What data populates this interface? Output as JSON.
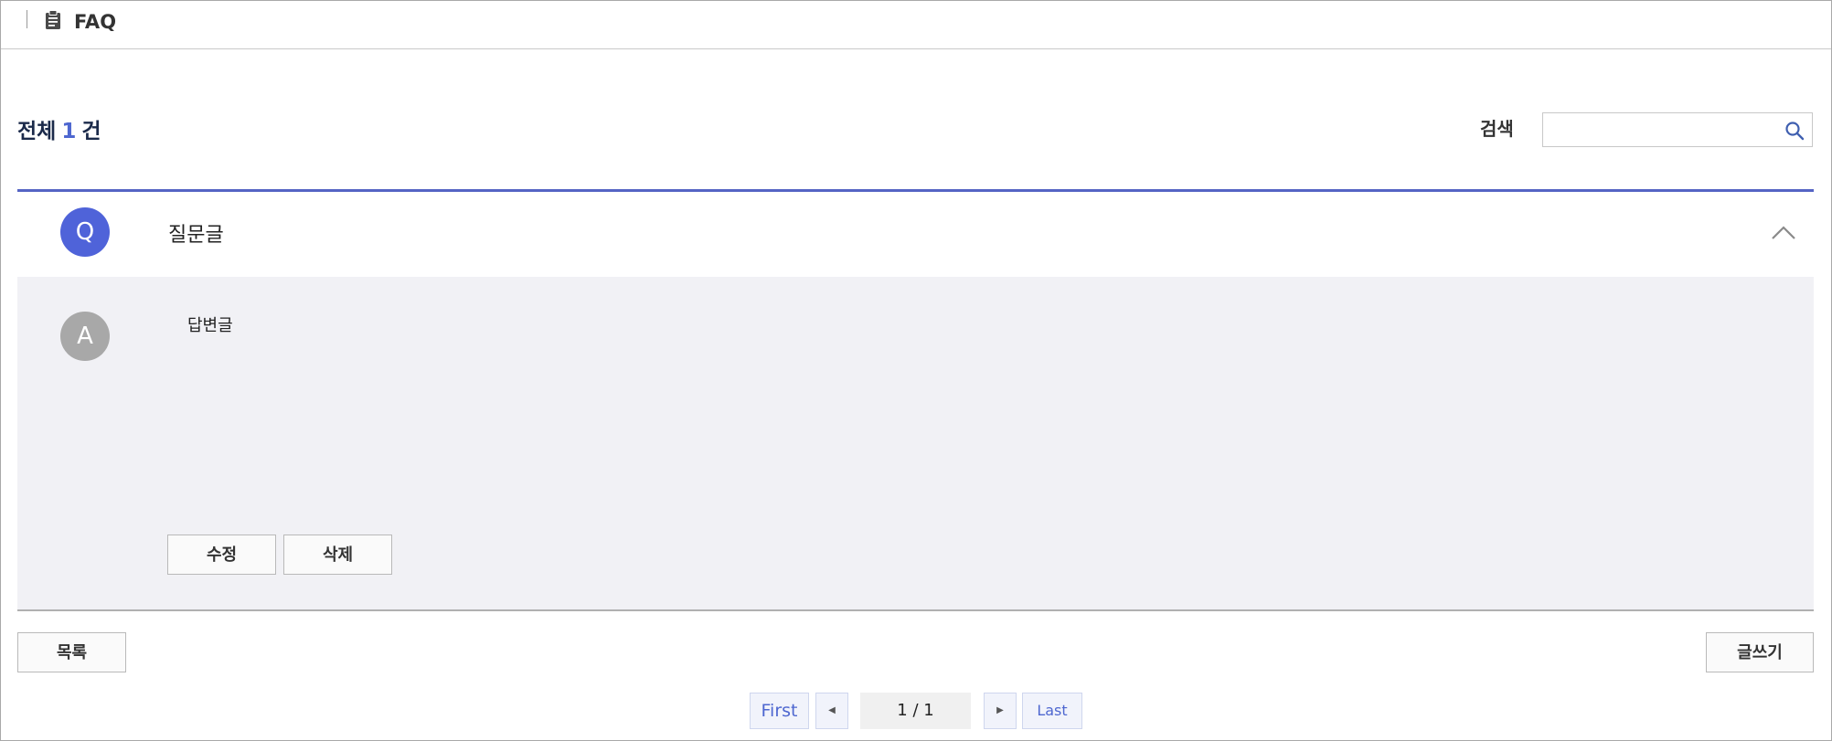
{
  "header": {
    "title": "FAQ",
    "icon": "clipboard-icon"
  },
  "summary": {
    "prefix": "전체",
    "count": "1",
    "suffix": "건"
  },
  "search": {
    "label": "검색",
    "value": "",
    "placeholder": ""
  },
  "faq_items": [
    {
      "question_badge": "Q",
      "question": "질문글",
      "answer_badge": "A",
      "answer": "답변글",
      "edit_label": "수정",
      "delete_label": "삭제",
      "expanded": true
    }
  ],
  "actions": {
    "list_label": "목록",
    "write_label": "글쓰기"
  },
  "pagination": {
    "first": "First",
    "last": "Last",
    "indicator": "1 / 1"
  },
  "colors": {
    "accent": "#4e67d0",
    "question_badge": "#4f63d9",
    "answer_badge": "#a8a8a8",
    "answer_bg": "#f1f1f5"
  }
}
